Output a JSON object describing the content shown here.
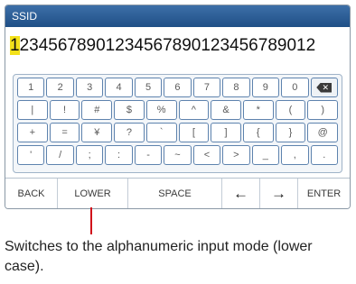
{
  "title": "SSID",
  "input": {
    "first_char": "1",
    "rest": "2345678901234567890123456789012"
  },
  "keys": {
    "row1": [
      "1",
      "2",
      "3",
      "4",
      "5",
      "6",
      "7",
      "8",
      "9",
      "0"
    ],
    "row2": [
      "|",
      "!",
      "#",
      "$",
      "%",
      "^",
      "&",
      "*",
      "(",
      ")"
    ],
    "row3": [
      "+",
      "=",
      "¥",
      "?",
      "`",
      "[",
      "]",
      "{",
      "}",
      "@"
    ],
    "row4": [
      "'",
      "/",
      ";",
      ":",
      "-",
      "~",
      "<",
      ">",
      "_",
      ",",
      "."
    ],
    "backspace_icon": "backspace-icon"
  },
  "bottom": {
    "back": "BACK",
    "lower": "LOWER",
    "space": "SPACE",
    "left_arrow": "←",
    "right_arrow": "→",
    "enter": "ENTER"
  },
  "caption": "Switches to the alphanumeric input mode (lower case).",
  "colors": {
    "title_bar": "#2b5d94",
    "highlight": "#f3e11a",
    "pointer": "#d10f1a"
  }
}
